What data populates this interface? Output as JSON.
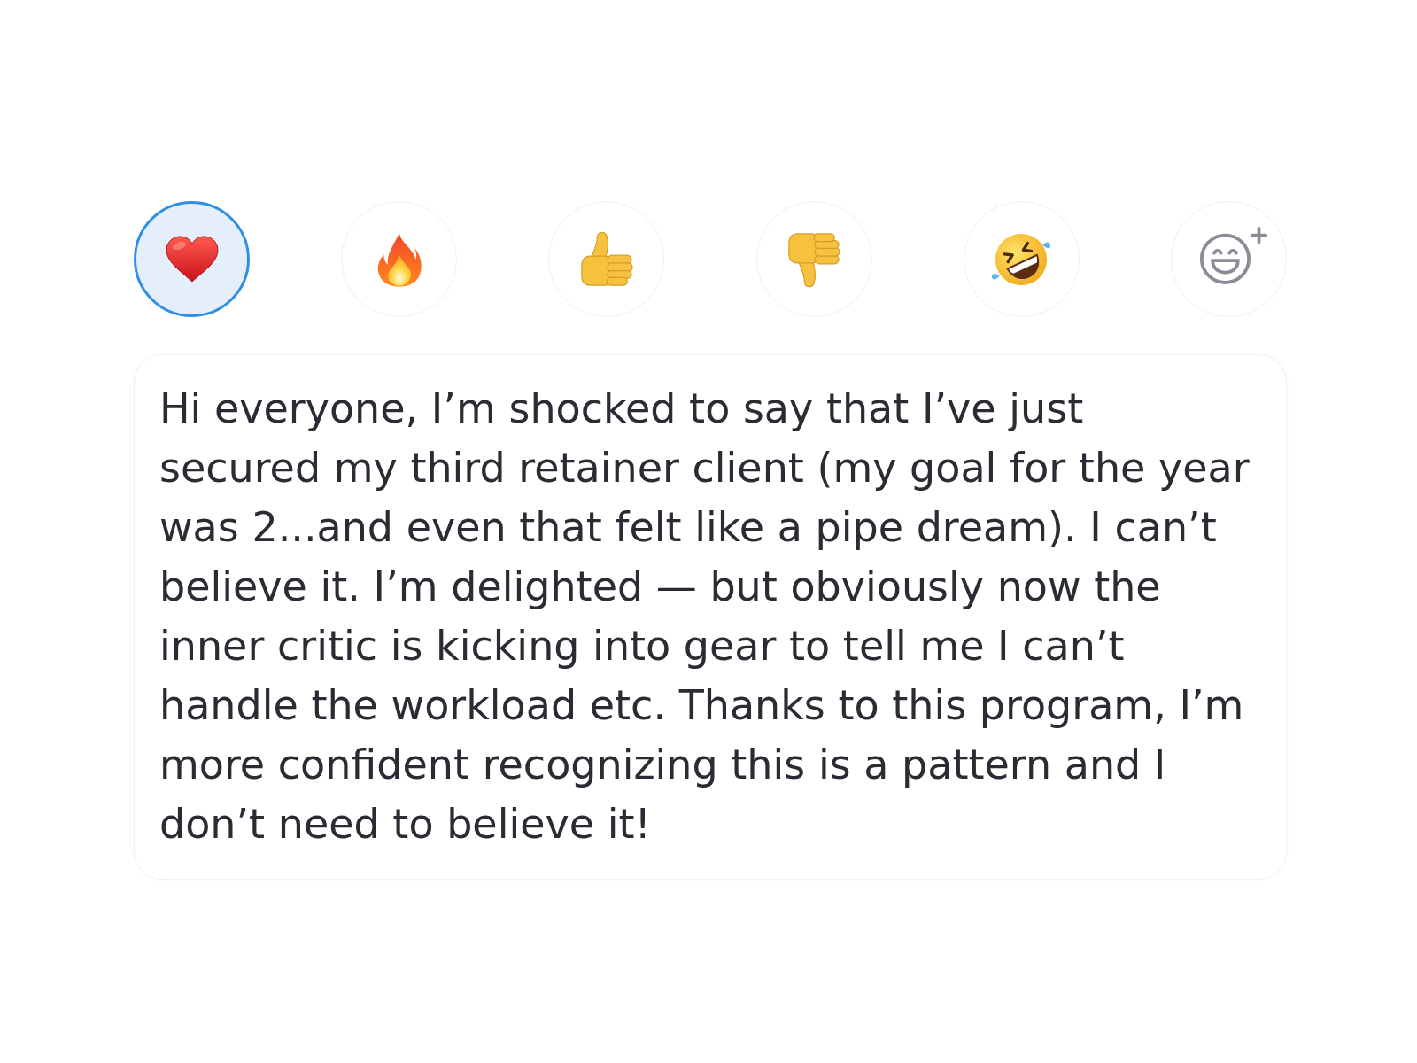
{
  "reactions": [
    {
      "kind": "heart",
      "selected": true
    },
    {
      "kind": "fire",
      "selected": false
    },
    {
      "kind": "thumbs_up",
      "selected": false
    },
    {
      "kind": "thumbs_down",
      "selected": false
    },
    {
      "kind": "laughing",
      "selected": false
    },
    {
      "kind": "add",
      "selected": false
    }
  ],
  "message": {
    "text": "Hi everyone, I’m shocked to say that I’ve just secured my third retainer client (my goal for the year was 2...and even that felt like a pipe dream). I can’t believe it. I’m delighted — but obviously now the inner critic is kicking into gear to tell me I can’t handle the workload etc. Thanks to this program, I’m more confident recognizing this is a pattern and I don’t need to believe it!"
  }
}
